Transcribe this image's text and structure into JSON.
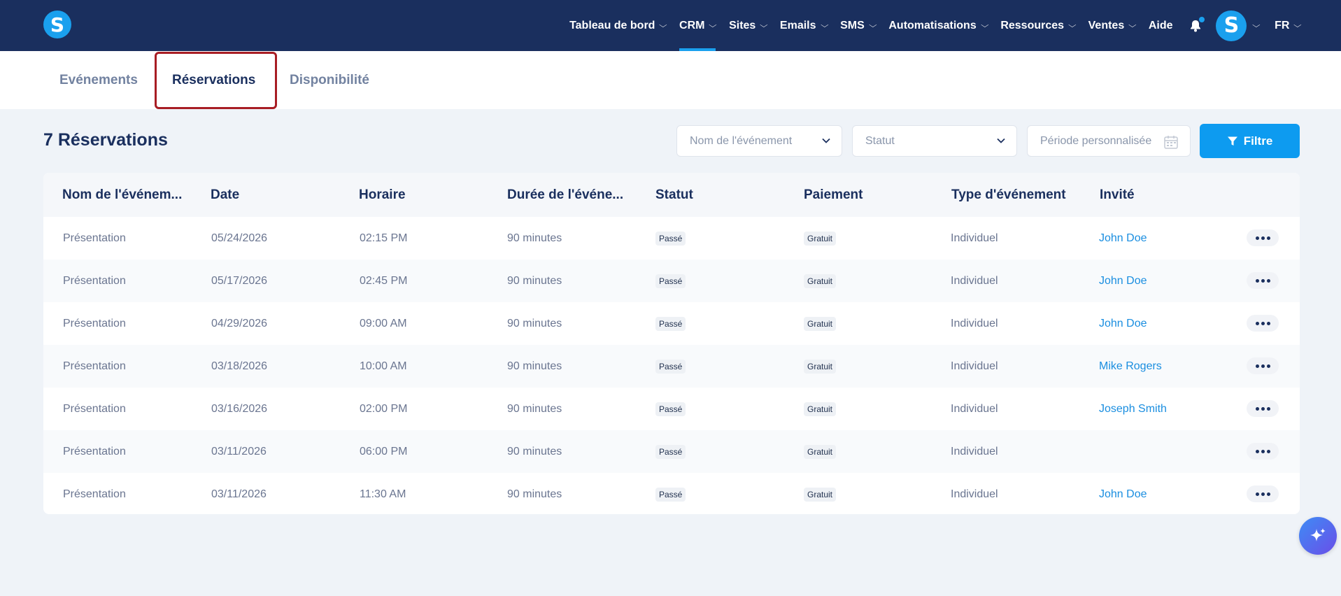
{
  "brand": {
    "logo_letter": "S",
    "color": "#1aa0ee"
  },
  "nav": {
    "items": [
      {
        "label": "Tableau de bord",
        "dropdown": true
      },
      {
        "label": "CRM",
        "dropdown": true,
        "active": true
      },
      {
        "label": "Sites",
        "dropdown": true
      },
      {
        "label": "Emails",
        "dropdown": true
      },
      {
        "label": "SMS",
        "dropdown": true
      },
      {
        "label": "Automatisations",
        "dropdown": true
      },
      {
        "label": "Ressources",
        "dropdown": true
      },
      {
        "label": "Ventes",
        "dropdown": true
      },
      {
        "label": "Aide",
        "dropdown": false
      }
    ],
    "avatar_letter": "S",
    "language": "FR"
  },
  "subtabs": [
    {
      "label": "Evénements"
    },
    {
      "label": "Réservations",
      "active": true
    },
    {
      "label": "Disponibilité"
    }
  ],
  "header": {
    "title": "7 Réservations",
    "event_filter_placeholder": "Nom de l'événement",
    "status_filter_placeholder": "Statut",
    "period_placeholder": "Période personnalisée",
    "filter_button": "Filtre"
  },
  "table": {
    "columns": [
      "Nom de l'événem...",
      "Date",
      "Horaire",
      "Durée de l'événe...",
      "Statut",
      "Paiement",
      "Type d'événement",
      "Invité"
    ],
    "rows": [
      {
        "event": "Présentation",
        "date": "05/24/2026",
        "time": "02:15 PM",
        "duration": "90 minutes",
        "status": "Passé",
        "payment": "Gratuit",
        "type": "Individuel",
        "guest": "John Doe"
      },
      {
        "event": "Présentation",
        "date": "05/17/2026",
        "time": "02:45 PM",
        "duration": "90 minutes",
        "status": "Passé",
        "payment": "Gratuit",
        "type": "Individuel",
        "guest": "John Doe"
      },
      {
        "event": "Présentation",
        "date": "04/29/2026",
        "time": "09:00 AM",
        "duration": "90 minutes",
        "status": "Passé",
        "payment": "Gratuit",
        "type": "Individuel",
        "guest": "John Doe"
      },
      {
        "event": "Présentation",
        "date": "03/18/2026",
        "time": "10:00 AM",
        "duration": "90 minutes",
        "status": "Passé",
        "payment": "Gratuit",
        "type": "Individuel",
        "guest": "Mike Rogers"
      },
      {
        "event": "Présentation",
        "date": "03/16/2026",
        "time": "02:00 PM",
        "duration": "90 minutes",
        "status": "Passé",
        "payment": "Gratuit",
        "type": "Individuel",
        "guest": "Joseph Smith"
      },
      {
        "event": "Présentation",
        "date": "03/11/2026",
        "time": "06:00 PM",
        "duration": "90 minutes",
        "status": "Passé",
        "payment": "Gratuit",
        "type": "Individuel",
        "guest": ""
      },
      {
        "event": "Présentation",
        "date": "03/11/2026",
        "time": "11:30 AM",
        "duration": "90 minutes",
        "status": "Passé",
        "payment": "Gratuit",
        "type": "Individuel",
        "guest": "John Doe"
      }
    ]
  },
  "colors": {
    "nav_bg": "#1a2f5e",
    "accent": "#0d9bf0",
    "link": "#1a8ee0",
    "highlight": "#a81d24"
  },
  "icons": [
    "chevron-down-icon",
    "bell-icon",
    "calendar-icon",
    "filter-icon",
    "more-icon",
    "sparkle-icon"
  ]
}
